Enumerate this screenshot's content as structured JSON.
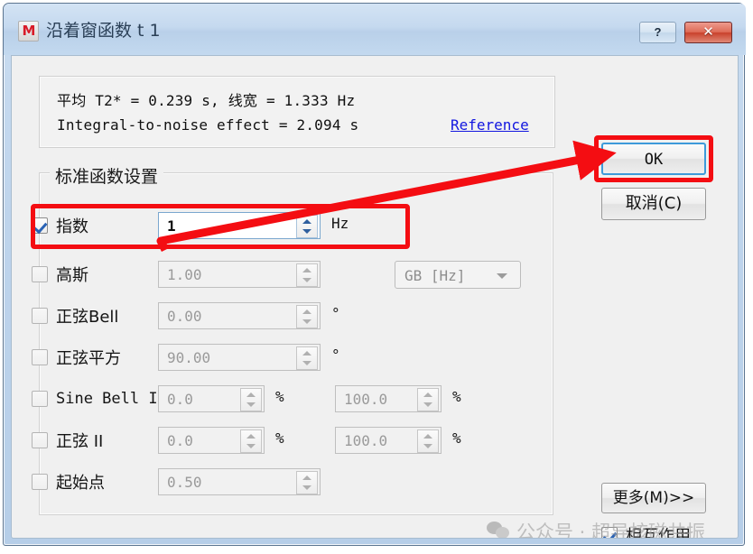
{
  "window": {
    "title": "沿着窗函数 t 1",
    "app_icon": "M",
    "help_button": "?",
    "close_button": "✕"
  },
  "info": {
    "line1": "平均 T2* = 0.239 s, 线宽 = 1.333 Hz",
    "line2": "Integral-to-noise effect = 2.094 s",
    "reference_link": "Reference"
  },
  "groupbox": {
    "title": "标准函数设置",
    "rows": [
      {
        "label": "指数",
        "checked": true,
        "enabled": true,
        "value": "1",
        "unit": "Hz",
        "value2": null,
        "unit2": null
      },
      {
        "label": "高斯",
        "checked": false,
        "enabled": false,
        "value": "1.00",
        "unit": "",
        "value2": null,
        "unit2": null
      },
      {
        "label": "正弦Bell",
        "checked": false,
        "enabled": false,
        "value": "0.00",
        "unit": "°",
        "value2": null,
        "unit2": null
      },
      {
        "label": "正弦平方",
        "checked": false,
        "enabled": false,
        "value": "90.00",
        "unit": "°",
        "value2": null,
        "unit2": null
      },
      {
        "label": "Sine Bell II",
        "checked": false,
        "enabled": false,
        "value": "0.0",
        "unit": "%",
        "value2": "100.0",
        "unit2": "%"
      },
      {
        "label": "正弦 II",
        "checked": false,
        "enabled": false,
        "value": "0.0",
        "unit": "%",
        "value2": "100.0",
        "unit2": "%"
      },
      {
        "label": "起始点",
        "checked": false,
        "enabled": false,
        "value": "0.50",
        "unit": "",
        "value2": null,
        "unit2": null
      }
    ],
    "gauss_combo_value": "GB [Hz]"
  },
  "buttons": {
    "ok": "OK",
    "cancel": "取消(C)",
    "more": "更多(M)>>"
  },
  "interaction_checkbox": {
    "label": "相互作用",
    "checked": true
  },
  "watermark": {
    "text": "公众号 · 超导核磁共振"
  },
  "colors": {
    "annotation_red": "#f40d12",
    "focus_blue": "#3d9ada",
    "link_blue": "#1216e0",
    "titlebar_blue": "#c5d9ef"
  }
}
